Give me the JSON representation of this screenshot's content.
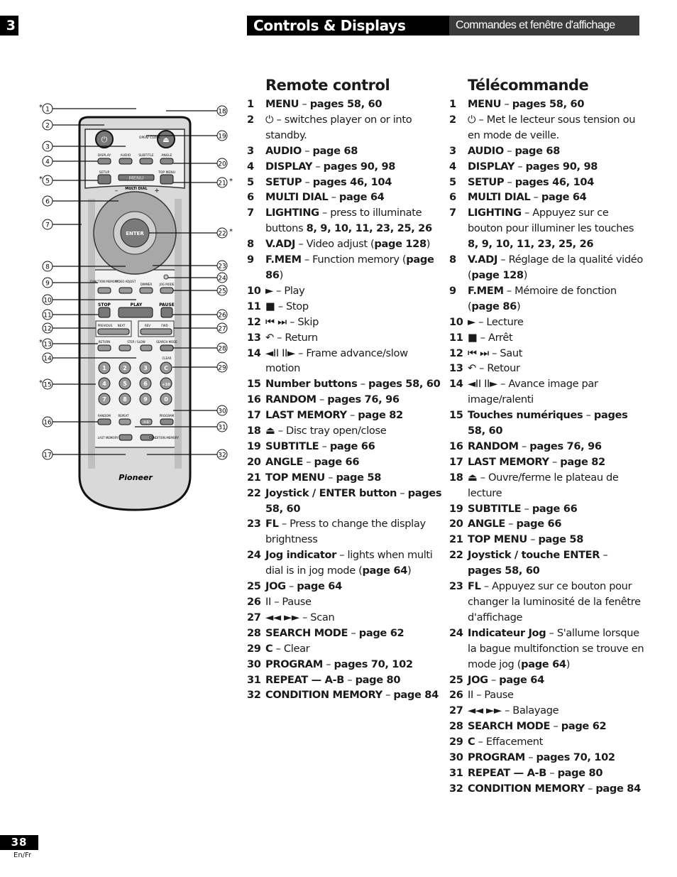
{
  "header": {
    "chapter": "3",
    "title_en": "Controls & Displays",
    "title_fr": "Commandes et fenêtre d'affichage"
  },
  "remote": {
    "brand": "Pioneer",
    "buttons": {
      "open_close": "OPEN/ CLOSE",
      "display": "DISPLAY",
      "audio": "AUDIO",
      "subtitle": "SUBTITLE",
      "angle": "ANGLE",
      "setup": "SETUP",
      "menu": "MENU",
      "top_menu": "TOP MENU",
      "multi_dial": "MULTI DIAL",
      "minus": "–",
      "plus": "+",
      "enter": "ENTER",
      "function_memory": "FUNCTION MEMORY",
      "video_adjust": "VIDEO ADJUST",
      "dimmer": "DIMMER",
      "jog_mode": "JOG MODE",
      "fmem": "F.MEM",
      "vadj": "V.ADJ",
      "fl": "FL",
      "jog": "JOG",
      "stop": "STOP",
      "play": "PLAY",
      "pause": "PAUSE",
      "previous": "PREVIOUS",
      "next": "NEXT",
      "rev": "REV",
      "fwd": "FWD",
      "return": "RETURN",
      "step_slow": "STEP / SLOW",
      "search_mode": "SEARCH MODE",
      "clear": "CLEAR",
      "c": "C",
      "random": "RANDOM",
      "repeat": "REPEAT",
      "ab": "A-B",
      "program": "PROGRAM",
      "last_memory": "LAST MEMORY",
      "condition_memory": "CONDITION MEMORY"
    },
    "numbers": [
      "1",
      "2",
      "3",
      "C",
      "4",
      "5",
      "6",
      "+10",
      "7",
      "8",
      "9",
      "0"
    ],
    "callouts_left": [
      {
        "num": "1",
        "star": true
      },
      {
        "num": "2",
        "star": false
      },
      {
        "num": "3",
        "star": false
      },
      {
        "num": "4",
        "star": false
      },
      {
        "num": "5",
        "star": true
      },
      {
        "num": "6",
        "star": false
      },
      {
        "num": "7",
        "star": false
      },
      {
        "num": "8",
        "star": false
      },
      {
        "num": "9",
        "star": false
      },
      {
        "num": "10",
        "star": false
      },
      {
        "num": "11",
        "star": false
      },
      {
        "num": "12",
        "star": false
      },
      {
        "num": "13",
        "star": true
      },
      {
        "num": "14",
        "star": false
      },
      {
        "num": "15",
        "star": true
      },
      {
        "num": "16",
        "star": false
      },
      {
        "num": "17",
        "star": false
      }
    ],
    "callouts_right": [
      {
        "num": "18",
        "star": false
      },
      {
        "num": "19",
        "star": false
      },
      {
        "num": "20",
        "star": false
      },
      {
        "num": "21",
        "star": true
      },
      {
        "num": "22",
        "star": true
      },
      {
        "num": "23",
        "star": false
      },
      {
        "num": "24",
        "star": false
      },
      {
        "num": "25",
        "star": false
      },
      {
        "num": "26",
        "star": false
      },
      {
        "num": "27",
        "star": false
      },
      {
        "num": "28",
        "star": false
      },
      {
        "num": "29",
        "star": false
      },
      {
        "num": "30",
        "star": false
      },
      {
        "num": "31",
        "star": false
      },
      {
        "num": "32",
        "star": false
      }
    ]
  },
  "english": {
    "heading": "Remote control",
    "items": [
      {
        "n": "1",
        "parts": [
          [
            "b",
            "MENU"
          ],
          [
            "t",
            " – "
          ],
          [
            "b",
            "pages 58, 60"
          ]
        ]
      },
      {
        "n": "2",
        "parts": [
          [
            "t",
            "⏻ – switches player on or into standby."
          ]
        ]
      },
      {
        "n": "3",
        "parts": [
          [
            "b",
            "AUDIO"
          ],
          [
            "t",
            " – "
          ],
          [
            "b",
            "page 68"
          ]
        ]
      },
      {
        "n": "4",
        "parts": [
          [
            "b",
            "DISPLAY"
          ],
          [
            "t",
            " – "
          ],
          [
            "b",
            "pages 90, 98"
          ]
        ]
      },
      {
        "n": "5",
        "parts": [
          [
            "b",
            "SETUP"
          ],
          [
            "t",
            " – "
          ],
          [
            "b",
            "pages 46, 104"
          ]
        ]
      },
      {
        "n": "6",
        "parts": [
          [
            "b",
            "MULTI DIAL"
          ],
          [
            "t",
            " – "
          ],
          [
            "b",
            "page 64"
          ]
        ]
      },
      {
        "n": "7",
        "parts": [
          [
            "b",
            "LIGHTING"
          ],
          [
            "t",
            " – press to illuminate buttons "
          ],
          [
            "b",
            "8, 9, 10, 11, 23, 25, 26"
          ]
        ]
      },
      {
        "n": "8",
        "parts": [
          [
            "b",
            "V.ADJ"
          ],
          [
            "t",
            " – Video adjust ("
          ],
          [
            "b",
            "page 128"
          ],
          [
            "t",
            ")"
          ]
        ]
      },
      {
        "n": "9",
        "parts": [
          [
            "b",
            "F.MEM"
          ],
          [
            "t",
            " – Function memory ("
          ],
          [
            "b",
            "page 86"
          ],
          [
            "t",
            ")"
          ]
        ]
      },
      {
        "n": "10",
        "parts": [
          [
            "t",
            "► – Play"
          ]
        ]
      },
      {
        "n": "11",
        "parts": [
          [
            "t",
            "■ – Stop"
          ]
        ]
      },
      {
        "n": "12",
        "parts": [
          [
            "t",
            "⏮ ⏭ – Skip"
          ]
        ]
      },
      {
        "n": "13",
        "parts": [
          [
            "t",
            "↶ – Return"
          ]
        ]
      },
      {
        "n": "14",
        "parts": [
          [
            "t",
            "◄II II► – Frame advance/slow motion"
          ]
        ]
      },
      {
        "n": "15",
        "parts": [
          [
            "b",
            "Number buttons"
          ],
          [
            "t",
            " – "
          ],
          [
            "b",
            "pages 58, 60"
          ]
        ]
      },
      {
        "n": "16",
        "parts": [
          [
            "b",
            "RANDOM"
          ],
          [
            "t",
            " – "
          ],
          [
            "b",
            "pages 76, 96"
          ]
        ]
      },
      {
        "n": "17",
        "parts": [
          [
            "b",
            "LAST MEMORY"
          ],
          [
            "t",
            " – "
          ],
          [
            "b",
            "page 82"
          ]
        ]
      },
      {
        "n": "18",
        "parts": [
          [
            "t",
            "⏏ – Disc tray open/close"
          ]
        ]
      },
      {
        "n": "19",
        "parts": [
          [
            "b",
            "SUBTITLE"
          ],
          [
            "t",
            " – "
          ],
          [
            "b",
            "page 66"
          ]
        ]
      },
      {
        "n": "20",
        "parts": [
          [
            "b",
            "ANGLE"
          ],
          [
            "t",
            " – "
          ],
          [
            "b",
            "page 66"
          ]
        ]
      },
      {
        "n": "21",
        "parts": [
          [
            "b",
            "TOP MENU"
          ],
          [
            "t",
            " – "
          ],
          [
            "b",
            "page 58"
          ]
        ]
      },
      {
        "n": "22",
        "parts": [
          [
            "b",
            "Joystick / ENTER button"
          ],
          [
            "t",
            " – "
          ],
          [
            "b",
            "pages 58, 60"
          ]
        ]
      },
      {
        "n": "23",
        "parts": [
          [
            "b",
            "FL"
          ],
          [
            "t",
            " – Press to change the display brightness"
          ]
        ]
      },
      {
        "n": "24",
        "parts": [
          [
            "b",
            "Jog indicator"
          ],
          [
            "t",
            " – lights when multi dial is in jog mode ("
          ],
          [
            "b",
            "page 64"
          ],
          [
            "t",
            ")"
          ]
        ]
      },
      {
        "n": "25",
        "parts": [
          [
            "b",
            "JOG"
          ],
          [
            "t",
            " – "
          ],
          [
            "b",
            "page 64"
          ]
        ]
      },
      {
        "n": "26",
        "parts": [
          [
            "t",
            "II – Pause"
          ]
        ]
      },
      {
        "n": "27",
        "parts": [
          [
            "t",
            "◄◄ ►► – Scan"
          ]
        ]
      },
      {
        "n": "28",
        "parts": [
          [
            "b",
            "SEARCH MODE"
          ],
          [
            "t",
            " – "
          ],
          [
            "b",
            "page 62"
          ]
        ]
      },
      {
        "n": "29",
        "parts": [
          [
            "b",
            "C"
          ],
          [
            "t",
            " – Clear"
          ]
        ]
      },
      {
        "n": "30",
        "parts": [
          [
            "b",
            "PROGRAM"
          ],
          [
            "t",
            " – "
          ],
          [
            "b",
            "pages 70, 102"
          ]
        ]
      },
      {
        "n": "31",
        "parts": [
          [
            "b",
            "REPEAT — A-B"
          ],
          [
            "t",
            " – "
          ],
          [
            "b",
            "page 80"
          ]
        ]
      },
      {
        "n": "32",
        "parts": [
          [
            "b",
            "CONDITION MEMORY"
          ],
          [
            "t",
            " – "
          ],
          [
            "b",
            "page 84"
          ]
        ]
      }
    ]
  },
  "french": {
    "heading": "Télécommande",
    "items": [
      {
        "n": "1",
        "parts": [
          [
            "b",
            "MENU"
          ],
          [
            "t",
            " – "
          ],
          [
            "b",
            "pages 58, 60"
          ]
        ]
      },
      {
        "n": "2",
        "parts": [
          [
            "t",
            "⏻ – Met le lecteur sous tension ou en mode de veille."
          ]
        ]
      },
      {
        "n": "3",
        "parts": [
          [
            "b",
            "AUDIO"
          ],
          [
            "t",
            " – "
          ],
          [
            "b",
            "page 68"
          ]
        ]
      },
      {
        "n": "4",
        "parts": [
          [
            "b",
            "DISPLAY"
          ],
          [
            "t",
            " – "
          ],
          [
            "b",
            "pages 90, 98"
          ]
        ]
      },
      {
        "n": "5",
        "parts": [
          [
            "b",
            "SETUP"
          ],
          [
            "t",
            " – "
          ],
          [
            "b",
            "pages 46, 104"
          ]
        ]
      },
      {
        "n": "6",
        "parts": [
          [
            "b",
            "MULTI DIAL"
          ],
          [
            "t",
            " – "
          ],
          [
            "b",
            "page 64"
          ]
        ]
      },
      {
        "n": "7",
        "parts": [
          [
            "b",
            "LIGHTING"
          ],
          [
            "t",
            " – Appuyez sur ce bouton pour illuminer les touches "
          ],
          [
            "b",
            "8, 9, 10, 11, 23, 25, 26"
          ]
        ]
      },
      {
        "n": "8",
        "parts": [
          [
            "b",
            "V.ADJ"
          ],
          [
            "t",
            " – Réglage de la qualité vidéo ("
          ],
          [
            "b",
            "page 128"
          ],
          [
            "t",
            ")"
          ]
        ]
      },
      {
        "n": "9",
        "parts": [
          [
            "b",
            "F.MEM"
          ],
          [
            "t",
            " – Mémoire de fonction ("
          ],
          [
            "b",
            "page 86"
          ],
          [
            "t",
            ")"
          ]
        ]
      },
      {
        "n": "10",
        "parts": [
          [
            "t",
            "► – Lecture"
          ]
        ]
      },
      {
        "n": "11",
        "parts": [
          [
            "t",
            "■ – Arrêt"
          ]
        ]
      },
      {
        "n": "12",
        "parts": [
          [
            "t",
            "⏮ ⏭ – Saut"
          ]
        ]
      },
      {
        "n": "13",
        "parts": [
          [
            "t",
            "↶ – Retour"
          ]
        ]
      },
      {
        "n": "14",
        "parts": [
          [
            "t",
            "◄II II► – Avance image par image/ralenti"
          ]
        ]
      },
      {
        "n": "15",
        "parts": [
          [
            "b",
            "Touches numériques"
          ],
          [
            "t",
            "  – "
          ],
          [
            "b",
            "pages 58, 60"
          ]
        ]
      },
      {
        "n": "16",
        "parts": [
          [
            "b",
            "RANDOM"
          ],
          [
            "t",
            " – "
          ],
          [
            "b",
            "pages 76, 96"
          ]
        ]
      },
      {
        "n": "17",
        "parts": [
          [
            "b",
            "LAST MEMORY"
          ],
          [
            "t",
            " – "
          ],
          [
            "b",
            "page 82"
          ]
        ]
      },
      {
        "n": "18",
        "parts": [
          [
            "t",
            "⏏ – Ouvre/ferme le plateau de lecture"
          ]
        ]
      },
      {
        "n": "19",
        "parts": [
          [
            "b",
            "SUBTITLE"
          ],
          [
            "t",
            " – "
          ],
          [
            "b",
            "page 66"
          ]
        ]
      },
      {
        "n": "20",
        "parts": [
          [
            "b",
            "ANGLE"
          ],
          [
            "t",
            " – "
          ],
          [
            "b",
            "page 66"
          ]
        ]
      },
      {
        "n": "21",
        "parts": [
          [
            "b",
            "TOP MENU"
          ],
          [
            "t",
            " – "
          ],
          [
            "b",
            "page 58"
          ]
        ]
      },
      {
        "n": "22",
        "parts": [
          [
            "b",
            "Joystick / touche ENTER"
          ],
          [
            "t",
            " – "
          ],
          [
            "b",
            "pages 58, 60"
          ]
        ]
      },
      {
        "n": "23",
        "parts": [
          [
            "b",
            "FL"
          ],
          [
            "t",
            " – Appuyez sur ce bouton pour changer la luminosité de la fenêtre d'affichage"
          ]
        ]
      },
      {
        "n": "24",
        "parts": [
          [
            "b",
            "Indicateur Jog"
          ],
          [
            "t",
            " – S'allume lorsque la bague multifonction se trouve en mode jog ("
          ],
          [
            "b",
            "page 64"
          ],
          [
            "t",
            ")"
          ]
        ]
      },
      {
        "n": "25",
        "parts": [
          [
            "b",
            "JOG"
          ],
          [
            "t",
            " – "
          ],
          [
            "b",
            "page 64"
          ]
        ]
      },
      {
        "n": "26",
        "parts": [
          [
            "t",
            "II – Pause"
          ]
        ]
      },
      {
        "n": "27",
        "parts": [
          [
            "t",
            "◄◄ ►► – Balayage"
          ]
        ]
      },
      {
        "n": "28",
        "parts": [
          [
            "b",
            "SEARCH MODE"
          ],
          [
            "t",
            " – "
          ],
          [
            "b",
            "page 62"
          ]
        ]
      },
      {
        "n": "29",
        "parts": [
          [
            "b",
            "C"
          ],
          [
            "t",
            " – Effacement"
          ]
        ]
      },
      {
        "n": "30",
        "parts": [
          [
            "b",
            "PROGRAM"
          ],
          [
            "t",
            " – "
          ],
          [
            "b",
            "pages 70, 102"
          ]
        ]
      },
      {
        "n": "31",
        "parts": [
          [
            "b",
            "REPEAT — A-B"
          ],
          [
            "t",
            " – "
          ],
          [
            "b",
            "page 80"
          ]
        ]
      },
      {
        "n": "32",
        "parts": [
          [
            "b",
            "CONDITION MEMORY"
          ],
          [
            "t",
            " – "
          ],
          [
            "b",
            "page 84"
          ]
        ]
      }
    ]
  },
  "footer": {
    "page_number": "38",
    "language": "En/Fr"
  }
}
